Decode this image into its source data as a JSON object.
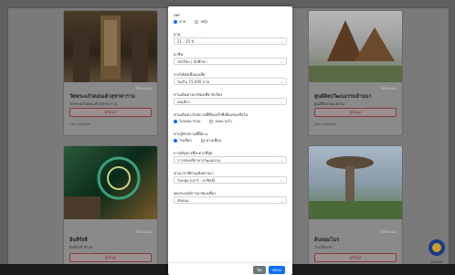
{
  "cards": [
    {
      "tag": "ได้คะแนน",
      "title": "วัดพระแก้วดอนเต้าสุชาดาราม",
      "sub": "วัดพระแก้วดอนเต้าสุชาดาราม",
      "button": "ดูข้อมูล",
      "foot": "Last updated"
    },
    {
      "tag": "ได้คะแนน",
      "title": "ศูนย์ศิลปวัฒนธรรมล้านนา",
      "sub": "ศูนย์ศิลปวัฒนธรรม",
      "button": "ดูข้อมูล",
      "foot": "Last updated"
    },
    {
      "tag": "ได้คะแนน",
      "title": "อินทิรังสี",
      "sub": "อินทิรังสี ตำบล",
      "button": "ดูข้อมูล",
      "foot": ""
    },
    {
      "tag": "ได้คะแนน",
      "title": "ดินจอมโนร",
      "sub": "โรงเรียนวัด",
      "button": "ดูข้อมูล",
      "foot": ""
    }
  ],
  "modal": {
    "fields": [
      {
        "label": "เพศ",
        "type": "radio",
        "options": [
          "ชาย",
          "หญิง"
        ],
        "selected": 0
      },
      {
        "label": "อายุ",
        "type": "select",
        "value": "21 - 25 ปี"
      },
      {
        "label": "อาชีพ",
        "type": "select",
        "value": "นักเรียน / นักศึกษา"
      },
      {
        "label": "รายได้ต่อเดือนเฉลี่ย",
        "type": "select",
        "value": "ไม่เกิน 15,000 บาท"
      },
      {
        "label": "ท่านเดินทางมาท่องเที่ยวกับใคร",
        "type": "select",
        "value": "คนเดียว"
      },
      {
        "label": "ท่านเดินทางไปสถานที่ที่ทุกครั้งที่เยี่ยมชมหรือไม่",
        "type": "radio",
        "options": [
          "ไม่เคยมาก่อน",
          "เคยมาแล้ว"
        ],
        "selected": 0
      },
      {
        "label": "ท่านรู้จักสถานที่นี้ผ่าน",
        "type": "radio",
        "options": [
          "โซเชียล",
          "ผ่านเพื่อน"
        ],
        "selected": 0
      },
      {
        "label": "การเดินทางที่สะดวกที่สุด",
        "type": "select",
        "value": "การท่องเที่ยวทางวัฒนธรรม"
      },
      {
        "label": "ช่วงเวลาที่ท่านเดินทางมา",
        "type": "select",
        "value": "วันหยุด (เสาร์ - อาทิตย์)"
      },
      {
        "label": "จุดประสงค์การมาท่องเที่ยว",
        "type": "select",
        "value": "พักผ่อน"
      }
    ],
    "close_label": "ปิด",
    "submit_label": "ตกลง"
  },
  "colors": {
    "primary": "#0d6efd",
    "secondary": "#6c757d",
    "danger": "#8a2a2a"
  },
  "badge_text": "สำนักงาน"
}
